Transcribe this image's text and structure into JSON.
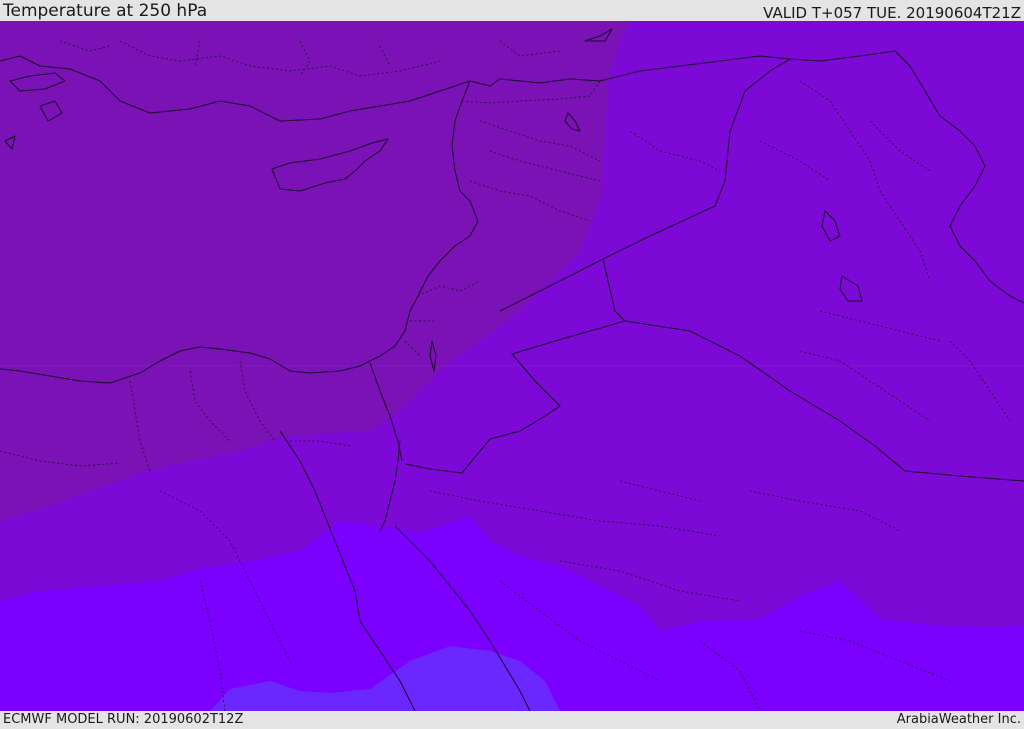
{
  "header": {
    "title": "Temperature at 250 hPa",
    "valid_time": "VALID T+057 TUE. 20190604T21Z"
  },
  "footer": {
    "model_run": "ECMWF MODEL RUN: 20190602T12Z",
    "credit": "ArabiaWeather Inc."
  },
  "colors": {
    "band_warmest": "#7a12b5",
    "band_warm": "#7c09d6",
    "band_mid": "#7a00ec",
    "band_cool": "#7b00ff",
    "band_coolest": "#6a28ff",
    "coastline": "#1a0a2a",
    "header_background": "#e4e4e4"
  }
}
